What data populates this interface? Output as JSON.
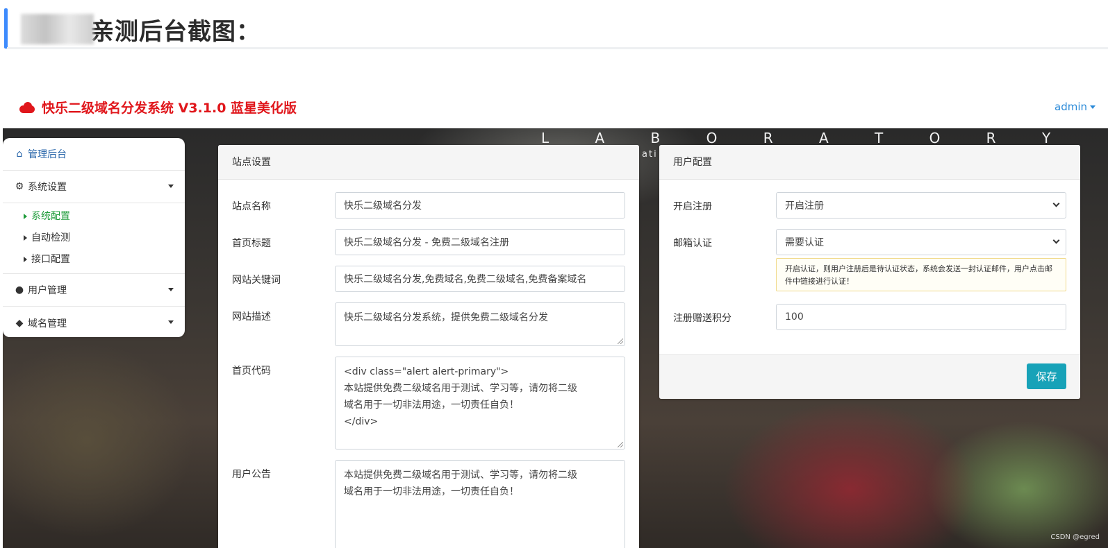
{
  "article": {
    "title": "亲测后台截图："
  },
  "navbar": {
    "brand": "快乐二级域名分发系统 V3.1.0 蓝星美化版",
    "user": "admin",
    "brand_icon": "cloud-icon",
    "brand_color": "#e0161b"
  },
  "background": {
    "headline": "L A B O R A T O R Y",
    "sub": "ati",
    "watermark": "CSDN @egred"
  },
  "sidebar": {
    "home": "管理后台",
    "sections": [
      {
        "label": "系统设置",
        "icon": "gear-icon",
        "items": [
          "系统配置",
          "自动检测",
          "接口配置"
        ],
        "active": "系统配置"
      },
      {
        "label": "用户管理",
        "icon": "user-icon"
      },
      {
        "label": "域名管理",
        "icon": "cube-icon"
      }
    ]
  },
  "site_settings": {
    "title": "站点设置",
    "fields": [
      {
        "label": "站点名称",
        "value": "快乐二级域名分发"
      },
      {
        "label": "首页标题",
        "value": "快乐二级域名分发 - 免费二级域名注册"
      },
      {
        "label": "网站关键词",
        "value": "快乐二级域名分发,免费域名,免费二级域名,免费备案域名"
      },
      {
        "label": "网站描述",
        "value": "快乐二级域名分发系统，提供免费二级域名分发"
      },
      {
        "label": "首页代码",
        "lines": [
          "<div class=\"alert alert-primary\">",
          "本站提供免费二级域名用于测试、学习等，请勿将二级",
          "域名用于一切非法用途，一切责任自负！",
          "</div>"
        ]
      },
      {
        "label": "用户公告",
        "lines": [
          "本站提供免费二级域名用于测试、学习等，请勿将二级",
          "域名用于一切非法用途，一切责任自负！"
        ]
      }
    ]
  },
  "user_config": {
    "title": "用户配置",
    "register": {
      "label": "开启注册",
      "value": "开启注册"
    },
    "email": {
      "label": "邮箱认证",
      "value": "需要认证",
      "hint": "开启认证，则用户注册后是待认证状态，系统会发送一封认证邮件，用户点击邮件中链接进行认证！"
    },
    "points": {
      "label": "注册赠送积分",
      "value": "100"
    },
    "save": "保存",
    "save_color": "#17a2b8"
  }
}
